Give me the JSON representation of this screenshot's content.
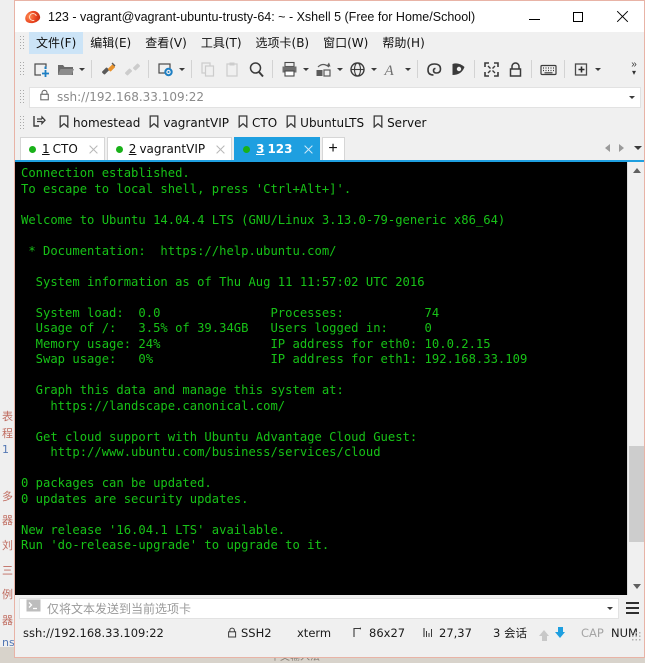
{
  "window": {
    "title": "123 - vagrant@vagrant-ubuntu-trusty-64: ~ - Xshell 5 (Free for Home/School)",
    "app_icon": "xshell-icon",
    "minimize_label": "Minimize",
    "maximize_label": "Maximize",
    "close_label": "Close"
  },
  "menubar": {
    "items": [
      {
        "label": "文件(F)",
        "name": "menu-file",
        "active": true
      },
      {
        "label": "编辑(E)",
        "name": "menu-edit",
        "active": false
      },
      {
        "label": "查看(V)",
        "name": "menu-view",
        "active": false
      },
      {
        "label": "工具(T)",
        "name": "menu-tools",
        "active": false
      },
      {
        "label": "选项卡(B)",
        "name": "menu-tabs",
        "active": false
      },
      {
        "label": "窗口(W)",
        "name": "menu-window",
        "active": false
      },
      {
        "label": "帮助(H)",
        "name": "menu-help",
        "active": false
      }
    ]
  },
  "toolbar": {
    "overflow_label": "»",
    "buttons": [
      {
        "name": "new-session-icon",
        "label": "New Session"
      },
      {
        "name": "open-folder-icon",
        "label": "Open"
      },
      {
        "name": "connect-icon",
        "label": "Connect"
      },
      {
        "name": "disconnect-icon",
        "label": "Disconnect"
      },
      {
        "name": "session-properties-icon",
        "label": "Properties"
      },
      {
        "name": "copy-icon",
        "label": "Copy"
      },
      {
        "name": "paste-icon",
        "label": "Paste"
      },
      {
        "name": "find-icon",
        "label": "Find"
      },
      {
        "name": "print-icon",
        "label": "Print"
      },
      {
        "name": "file-transfer-icon",
        "label": "File Transfer"
      },
      {
        "name": "globe-icon",
        "label": "Tunneling"
      },
      {
        "name": "font-icon",
        "label": "Font"
      },
      {
        "name": "xftp-icon",
        "label": "Xftp"
      },
      {
        "name": "xagent-icon",
        "label": "Xagent"
      },
      {
        "name": "fullscreen-icon",
        "label": "Full Screen"
      },
      {
        "name": "lock-icon",
        "label": "Lock"
      },
      {
        "name": "keyboard-icon",
        "label": "Keyboard"
      },
      {
        "name": "add-pane-icon",
        "label": "Add Pane"
      }
    ]
  },
  "address": {
    "value": "ssh://192.168.33.109:22",
    "lock_icon": "lock-icon"
  },
  "bookmarks": {
    "open_icon": "open-session-icon",
    "items": [
      {
        "label": "homestead",
        "name": "bookmark-homestead"
      },
      {
        "label": "vagrantVIP",
        "name": "bookmark-vagrantvip"
      },
      {
        "label": "CTO",
        "name": "bookmark-cto"
      },
      {
        "label": "UbuntuLTS",
        "name": "bookmark-ubuntults"
      },
      {
        "label": "Server",
        "name": "bookmark-server"
      }
    ]
  },
  "tabs": {
    "items": [
      {
        "num": "1",
        "label": "CTO",
        "active": false,
        "name": "tab-cto"
      },
      {
        "num": "2",
        "label": "vagrantVIP",
        "active": false,
        "name": "tab-vagrantvip"
      },
      {
        "num": "3",
        "label": "123",
        "active": true,
        "name": "tab-123"
      }
    ],
    "add_label": "+"
  },
  "terminal": {
    "lines": [
      "Connection established.",
      "To escape to local shell, press 'Ctrl+Alt+]'.",
      "",
      "Welcome to Ubuntu 14.04.4 LTS (GNU/Linux 3.13.0-79-generic x86_64)",
      "",
      " * Documentation:  https://help.ubuntu.com/",
      "",
      "  System information as of Thu Aug 11 11:57:02 UTC 2016",
      "",
      "  System load:  0.0               Processes:           74",
      "  Usage of /:   3.5% of 39.34GB   Users logged in:     0",
      "  Memory usage: 24%               IP address for eth0: 10.0.2.15",
      "  Swap usage:   0%                IP address for eth1: 192.168.33.109",
      "",
      "  Graph this data and manage this system at:",
      "    https://landscape.canonical.com/",
      "",
      "  Get cloud support with Ubuntu Advantage Cloud Guest:",
      "    http://www.ubuntu.com/business/services/cloud",
      "",
      "0 packages can be updated.",
      "0 updates are security updates.",
      "",
      "New release '16.04.1 LTS' available.",
      "Run 'do-release-upgrade' to upgrade to it.",
      ""
    ],
    "fg_color": "#17c217",
    "bg_color": "#000000"
  },
  "sendbar": {
    "placeholder": "仅将文本发送到当前选项卡",
    "prompt_icon": "terminal-prompt-icon",
    "menu_icon": "hamburger-menu-icon"
  },
  "statusbar": {
    "url": "ssh://192.168.33.109:22",
    "protocol": "SSH2",
    "terminal_type": "xterm",
    "size": "86x27",
    "cursor": "27,37",
    "sessions": "3 会话",
    "caps": "CAP",
    "num": "NUM",
    "upload_icon": "upload-arrow-icon",
    "download_icon": "download-arrow-icon"
  },
  "background": {
    "bottom_text": "中文输入法"
  }
}
